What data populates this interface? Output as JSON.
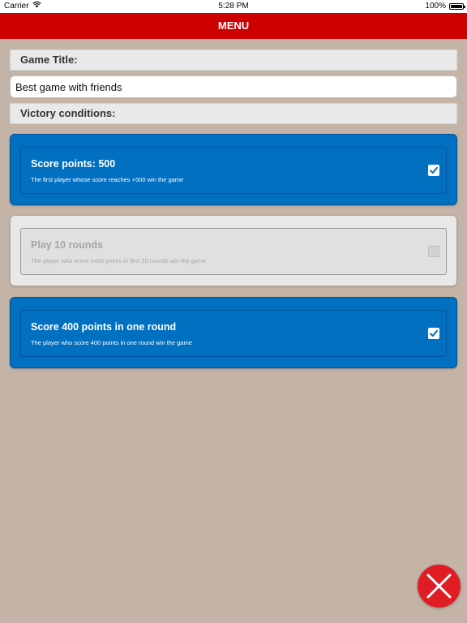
{
  "status_bar": {
    "carrier": "Carrier",
    "time": "5:28 PM",
    "battery": "100%"
  },
  "header": {
    "title": "MENU"
  },
  "game_title": {
    "label": "Game Title:",
    "value": "Best game with friends"
  },
  "victory": {
    "label": "Victory conditions:",
    "conditions": [
      {
        "title": "Score points: 500",
        "description": "The first player whose score reaches +500 win the game",
        "checked": true
      },
      {
        "title": "Play 10 rounds",
        "description": "The player who score most points in first 10 rounds win the game",
        "checked": false
      },
      {
        "title": "Score 400 points in one round",
        "description": "The player who score 400 points in one round win the game",
        "checked": true
      }
    ]
  },
  "icons": {
    "wifi": "wifi-icon",
    "battery": "battery-icon",
    "checkmark": "checkmark-icon",
    "close": "close-icon"
  },
  "colors": {
    "header_bg": "#cc0000",
    "background": "#c4b3a7",
    "active_card": "#0170c1",
    "inactive_card": "#e8e8e8",
    "close_button": "#e01d25"
  }
}
